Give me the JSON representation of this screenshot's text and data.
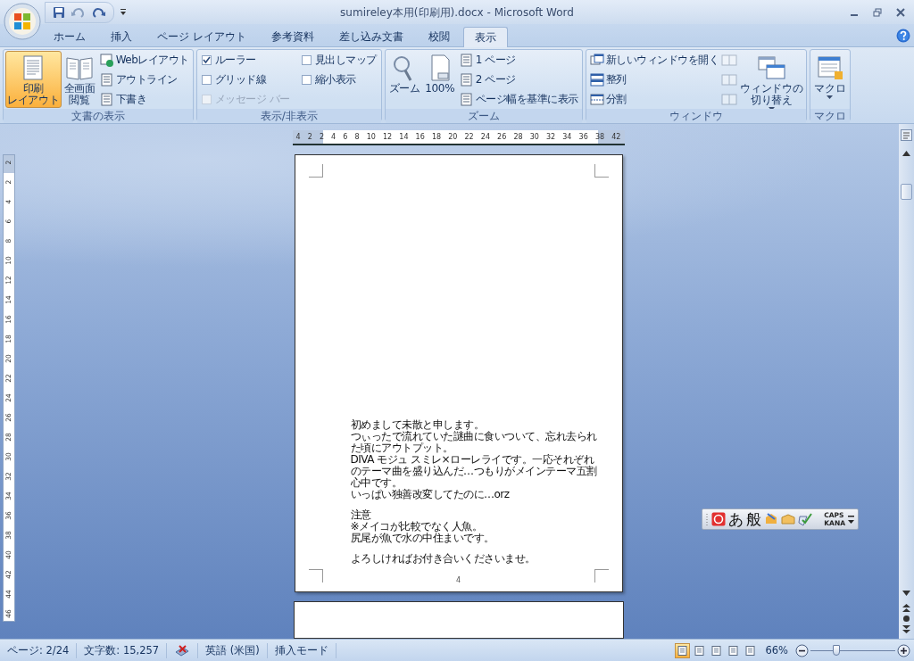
{
  "window": {
    "title": "sumireley本用(印刷用).docx - Microsoft Word"
  },
  "tabs": [
    {
      "label": "ホーム",
      "selected": false
    },
    {
      "label": "挿入",
      "selected": false
    },
    {
      "label": "ページ レイアウト",
      "selected": false
    },
    {
      "label": "参考資料",
      "selected": false
    },
    {
      "label": "差し込み文書",
      "selected": false
    },
    {
      "label": "校閲",
      "selected": false
    },
    {
      "label": "表示",
      "selected": true
    }
  ],
  "ribbon": {
    "groups": [
      {
        "label": "文書の表示",
        "columns": [
          [
            {
              "kind": "large",
              "label": [
                "印刷",
                "レイアウト"
              ],
              "selected": true
            }
          ],
          [
            {
              "kind": "large",
              "label": [
                "全画面",
                "閲覧"
              ],
              "selected": false
            }
          ],
          [
            {
              "kind": "small",
              "label": "Webレイアウト"
            },
            {
              "kind": "small",
              "label": "アウトライン"
            },
            {
              "kind": "small",
              "label": "下書き"
            }
          ]
        ]
      },
      {
        "label": "表示/非表示",
        "columns": [
          [
            {
              "kind": "checkbox",
              "label": "ルーラー",
              "checked": true,
              "disabled": false
            },
            {
              "kind": "checkbox",
              "label": "グリッド線",
              "checked": false,
              "disabled": false
            },
            {
              "kind": "checkbox",
              "label": "メッセージ バー",
              "checked": false,
              "disabled": true
            }
          ],
          [
            {
              "kind": "checkbox",
              "label": "見出しマップ",
              "checked": false,
              "disabled": false
            },
            {
              "kind": "checkbox",
              "label": "縮小表示",
              "checked": false,
              "disabled": false
            }
          ]
        ]
      },
      {
        "label": "ズーム",
        "columns": [
          [
            {
              "kind": "large",
              "label": [
                "ズーム"
              ],
              "selected": false
            }
          ],
          [
            {
              "kind": "large",
              "label": [
                "100%"
              ],
              "selected": false
            }
          ],
          [
            {
              "kind": "small",
              "label": "1 ページ"
            },
            {
              "kind": "small",
              "label": "2 ページ"
            },
            {
              "kind": "small",
              "label": "ページ幅を基準に表示"
            }
          ]
        ]
      },
      {
        "label": "ウィンドウ",
        "columns": [
          [
            {
              "kind": "small",
              "label": "新しいウィンドウを開く"
            },
            {
              "kind": "small",
              "label": "整列"
            },
            {
              "kind": "small",
              "label": "分割"
            }
          ],
          [
            {
              "kind": "mini",
              "disabled": true
            },
            {
              "kind": "mini",
              "disabled": true
            },
            {
              "kind": "mini",
              "disabled": true
            }
          ],
          [
            {
              "kind": "large",
              "label": [
                "ウィンドウの",
                "切り替え"
              ],
              "selected": false,
              "dropdown": true
            }
          ]
        ]
      },
      {
        "label": "マクロ",
        "columns": [
          [
            {
              "kind": "large",
              "label": [
                "マクロ"
              ],
              "selected": false,
              "dropdown": true
            }
          ]
        ]
      }
    ]
  },
  "horizontal_ruler": {
    "labels": [
      "4",
      "2",
      "2",
      "4",
      "6",
      "8",
      "10",
      "12",
      "14",
      "16",
      "18",
      "20",
      "22",
      "24",
      "26",
      "28",
      "30",
      "32",
      "34",
      "36",
      "38",
      "42"
    ]
  },
  "vertical_ruler": {
    "labels": [
      "2",
      "2",
      "4",
      "6",
      "8",
      "10",
      "12",
      "14",
      "16",
      "18",
      "20",
      "22",
      "24",
      "26",
      "28",
      "30",
      "32",
      "34",
      "36",
      "38",
      "40",
      "42",
      "44",
      "46"
    ]
  },
  "page": {
    "blocks": [
      [
        "初めまして未散と申します。",
        "つぃったで流れていた謎曲に食いついて、忘れ去られ",
        "た頃にアウトプット。",
        "DIVA モジュ スミレ×ローレライです。一応それぞれ",
        "のテーマ曲を盛り込んだ…つもりがメインテーマ五割",
        "心中です。",
        "いっぱい独善改変してたのに…orz"
      ],
      [
        "注意",
        "※メイコが比較でなく人魚。",
        "尻尾が魚で水の中住まいです。"
      ],
      [
        "よろしければお付き合いくださいませ。"
      ]
    ],
    "page_number": "4"
  },
  "ime_bar": {
    "mode": "あ",
    "dictionary": "般",
    "caps": "CAPS",
    "kana": "KANA"
  },
  "status_bar": {
    "page": "ページ: 2/24",
    "word_count": "文字数: 15,257",
    "language": "英語 (米国)",
    "mode": "挿入モード",
    "views": [
      {
        "selected": true
      },
      {
        "selected": false
      },
      {
        "selected": false
      },
      {
        "selected": false
      },
      {
        "selected": false
      }
    ],
    "zoom": "66%",
    "zoom_slider": {
      "level": 0.3
    }
  }
}
